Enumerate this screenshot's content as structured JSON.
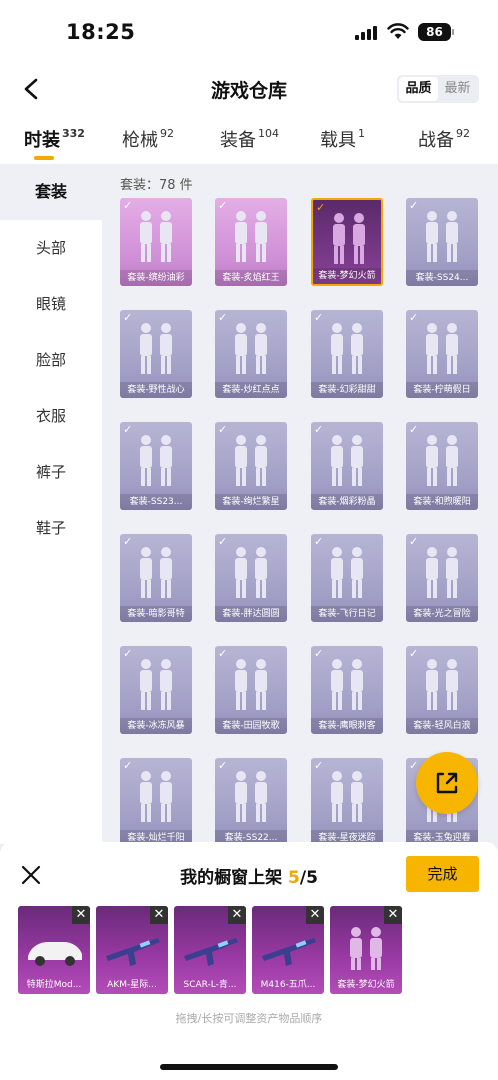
{
  "status": {
    "time": "18:25",
    "battery": "86"
  },
  "header": {
    "title": "游戏仓库",
    "sort_options": [
      "品质",
      "最新"
    ]
  },
  "tabs": [
    {
      "label": "时装",
      "count": "332"
    },
    {
      "label": "枪械",
      "count": "92"
    },
    {
      "label": "装备",
      "count": "104"
    },
    {
      "label": "载具",
      "count": "1"
    },
    {
      "label": "战备",
      "count": "92"
    }
  ],
  "sidebar": {
    "items": [
      "套装",
      "头部",
      "眼镜",
      "脸部",
      "衣服",
      "裤子",
      "鞋子"
    ]
  },
  "content": {
    "count_label": "套装：78 件",
    "items": [
      "套装-缤纷油彩",
      "套装-炙焰红王",
      "套装-梦幻火箭",
      "套装-SS24...",
      "套装-野性战心",
      "套装-炒红点点",
      "套装-幻彩甜甜",
      "套装-柠萌假日",
      "套装-SS23...",
      "套装-绚烂繁星",
      "套装-烟彩粉晶",
      "套装-和煦暖阳",
      "套装-暗影哥特",
      "套装-胖达圆圆",
      "套装-飞行日记",
      "套装-光之冒险",
      "套装-冰冻风暴",
      "套装-田园牧歌",
      "套装-鹰眼刺客",
      "套装-轻风白浪",
      "套装-灿烂千阳",
      "套装-SS22...",
      "套装-星夜迷踪",
      "套装-玉兔迎春"
    ]
  },
  "sheet": {
    "title_prefix": "我的橱窗上架",
    "current": "5",
    "total": "/5",
    "done_label": "完成",
    "items": [
      "特斯拉Mod...",
      "AKM-星际...",
      "SCAR-L-青...",
      "M416-五爪...",
      "套装-梦幻火箭"
    ],
    "hint": "拖拽/长按可调整资产物品顺序"
  },
  "colors": {
    "accent": "#f7b500",
    "selected_border": "#f5a800"
  }
}
